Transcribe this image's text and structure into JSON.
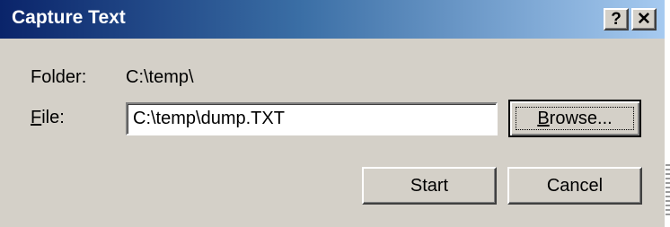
{
  "window": {
    "title": "Capture Text",
    "help_glyph": "?",
    "close_glyph": "✕"
  },
  "folder": {
    "label": "Folder:",
    "value": "C:\\temp\\"
  },
  "file": {
    "label_mnemonic": "F",
    "label_rest": "ile:",
    "value": "C:\\temp\\dump.TXT"
  },
  "buttons": {
    "browse_mnemonic": "B",
    "browse_rest": "rowse...",
    "start": "Start",
    "cancel": "Cancel"
  },
  "colors": {
    "dialog_bg": "#d4d0c8",
    "titlebar_start": "#0a246a",
    "titlebar_end": "#a6caf0"
  },
  "icons": {
    "help": "help-icon",
    "close": "close-icon"
  }
}
